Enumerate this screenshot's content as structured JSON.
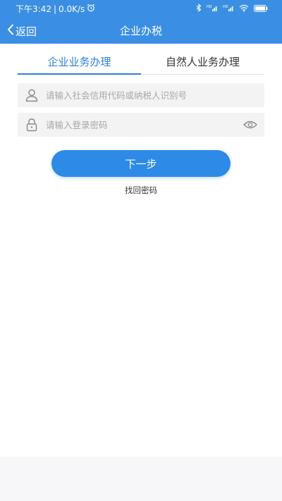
{
  "status_bar": {
    "time": "下午3:42",
    "separator": "|",
    "speed": "0.0K/s",
    "icons": [
      "alarm-icon",
      "bluetooth-icon",
      "signal-hd-icon",
      "signal-hd-icon",
      "wifi-icon",
      "battery-icon"
    ]
  },
  "nav": {
    "back_label": "返回",
    "title": "企业办税"
  },
  "tabs": [
    {
      "label": "企业业务办理",
      "active": true
    },
    {
      "label": "自然人业务办理",
      "active": false
    }
  ],
  "form": {
    "account_placeholder": "请输入社会信用代码或纳税人识别号",
    "password_placeholder": "请输入登录密码"
  },
  "actions": {
    "next_label": "下一步",
    "find_password_label": "找回密码"
  },
  "colors": {
    "header_bg": "#3a8fe4",
    "accent": "#2f7fd6",
    "button_bg": "#2d8ae6"
  }
}
